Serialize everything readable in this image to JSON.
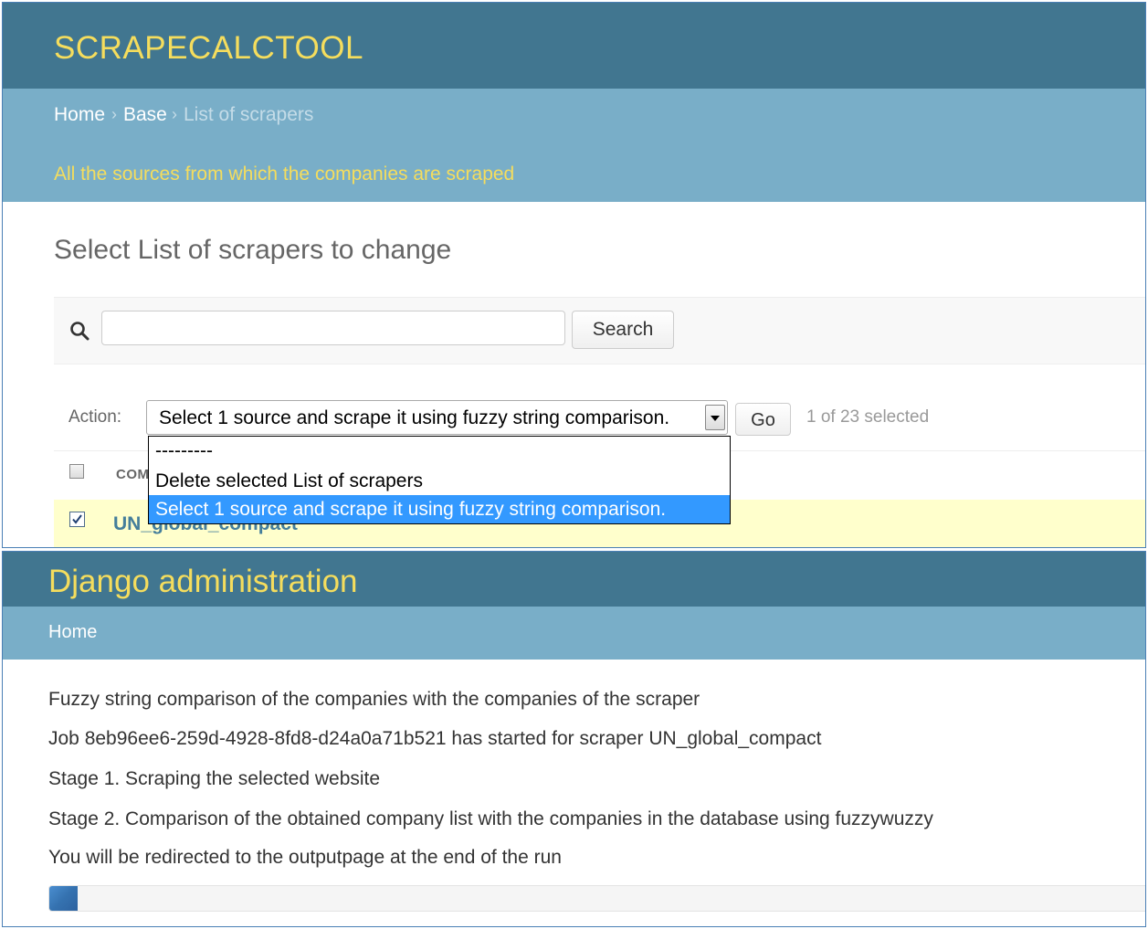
{
  "top_panel": {
    "site_title": "SCRAPECALCTOOL",
    "breadcrumb": {
      "home": "Home",
      "sep": "›",
      "base": "Base",
      "current": "List of scrapers"
    },
    "site_description": "All the sources from which the companies are scraped",
    "page_title": "Select List of scrapers to change",
    "search": {
      "value": "",
      "placeholder": "",
      "button_label": "Search"
    },
    "actions": {
      "label": "Action:",
      "selected_value": "Select 1 source and scrape it using fuzzy string comparison.",
      "go_label": "Go",
      "counter": "1 of 23 selected",
      "options": [
        "---------",
        "Delete selected List of scrapers",
        "Select 1 source and scrape it using fuzzy string comparison."
      ],
      "highlighted_index": 2
    },
    "table": {
      "column_header": "COM",
      "rows": [
        {
          "name": "UN_global_compact",
          "checked": true
        }
      ]
    }
  },
  "bottom_panel": {
    "site_title": "Django administration",
    "breadcrumb_home": "Home",
    "messages": [
      "Fuzzy string comparison of the companies with the companies of the scraper",
      "Job 8eb96ee6-259d-4928-8fd8-d24a0a71b521 has started for scraper UN_global_compact",
      "Stage 1. Scraping the selected website",
      "Stage 2. Comparison of the obtained company list with the companies in the database using fuzzywuzzy",
      "You will be redirected to the outputpage at the end of the run"
    ],
    "progress_percent": 2.6
  },
  "colors": {
    "header_bg": "#417690",
    "breadcrumb_bg": "#79aec8",
    "brand_yellow": "#f5dd5d",
    "selected_row_bg": "#ffffcc",
    "dropdown_highlight": "#3399ff",
    "link_blue": "#447e9b"
  }
}
